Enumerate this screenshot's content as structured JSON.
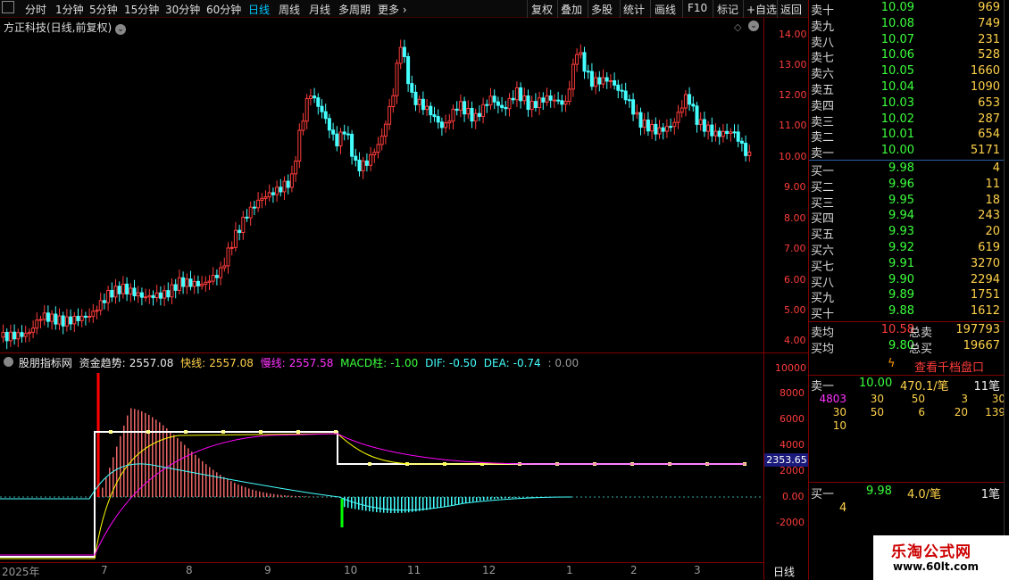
{
  "toolbar": {
    "periods": [
      "分时",
      "1分钟",
      "5分钟",
      "15分钟",
      "30分钟",
      "60分钟",
      "日线",
      "周线",
      "月线",
      "多周期",
      "更多"
    ],
    "active_period": "日线",
    "right_items": [
      "复权",
      "叠加",
      "多股",
      "统计",
      "画线",
      "F10",
      "标记",
      "+自选",
      "返回"
    ]
  },
  "main_title": "方正科技(日线,前复权)",
  "price_axis": [
    "14.00",
    "13.00",
    "12.00",
    "11.00",
    "10.00",
    "9.00",
    "8.00",
    "7.00",
    "6.00",
    "5.00",
    "4.00"
  ],
  "indicator_axis": [
    "10000",
    "8000",
    "6000",
    "4000",
    "2000",
    "0.00",
    "-2000"
  ],
  "indicator_value_badge": "2353.65",
  "legend": {
    "name": "股朋指标网",
    "trend_label": "资金趋势:",
    "trend_value": "2557.08",
    "fast_label": "快线:",
    "fast_value": "2557.08",
    "slow_label": "慢线:",
    "slow_value": "2557.58",
    "macd_label": "MACD柱:",
    "macd_value": "-1.00",
    "dif_label": "DIF:",
    "dif_value": "-0.50",
    "dea_label": "DEA:",
    "dea_value": "-0.74",
    "extra": ": 0.00"
  },
  "date_axis": {
    "labels": [
      "2025年",
      "7",
      "8",
      "9",
      "10",
      "11",
      "12",
      "1",
      "2",
      "3"
    ],
    "period": "日线"
  },
  "orderbook": {
    "asks": [
      {
        "label": "卖十",
        "price": "10.09",
        "vol": "969"
      },
      {
        "label": "卖九",
        "price": "10.08",
        "vol": "749"
      },
      {
        "label": "卖八",
        "price": "10.07",
        "vol": "231"
      },
      {
        "label": "卖七",
        "price": "10.06",
        "vol": "528"
      },
      {
        "label": "卖六",
        "price": "10.05",
        "vol": "1660"
      },
      {
        "label": "卖五",
        "price": "10.04",
        "vol": "1090"
      },
      {
        "label": "卖四",
        "price": "10.03",
        "vol": "653"
      },
      {
        "label": "卖三",
        "price": "10.02",
        "vol": "287"
      },
      {
        "label": "卖二",
        "price": "10.01",
        "vol": "654"
      },
      {
        "label": "卖一",
        "price": "10.00",
        "vol": "5171"
      }
    ],
    "bids": [
      {
        "label": "买一",
        "price": "9.98",
        "vol": "4"
      },
      {
        "label": "买二",
        "price": "9.96",
        "vol": "11"
      },
      {
        "label": "买三",
        "price": "9.95",
        "vol": "18"
      },
      {
        "label": "买四",
        "price": "9.94",
        "vol": "243"
      },
      {
        "label": "买五",
        "price": "9.93",
        "vol": "20"
      },
      {
        "label": "买六",
        "price": "9.92",
        "vol": "619"
      },
      {
        "label": "买七",
        "price": "9.91",
        "vol": "3270"
      },
      {
        "label": "买八",
        "price": "9.90",
        "vol": "2294"
      },
      {
        "label": "买九",
        "price": "9.89",
        "vol": "1751"
      },
      {
        "label": "买十",
        "price": "9.88",
        "vol": "1612"
      }
    ],
    "avg_ask_label": "卖均",
    "avg_ask": "10.58",
    "total_ask_label": "总卖",
    "total_ask": "197793",
    "avg_bid_label": "买均",
    "avg_bid": "9.80",
    "total_bid_label": "总买",
    "total_bid": "19667"
  },
  "thousand_link": "查看千档盘口",
  "queue": {
    "ask_label": "卖一",
    "ask_price": "10.00",
    "ask_avg": "470.1/笔",
    "ask_count": "11笔",
    "ask_rows": [
      [
        "4803",
        "30",
        "50",
        "3",
        "30"
      ],
      [
        "30",
        "50",
        "6",
        "20",
        "139"
      ],
      [
        "10"
      ]
    ],
    "bid_label": "买一",
    "bid_price": "9.98",
    "bid_avg": "4.0/笔",
    "bid_count": "1笔",
    "bid_rows": [
      [
        "4"
      ]
    ]
  },
  "watermark": {
    "line1": "乐淘公式网",
    "line2": "www.60lt.com"
  },
  "colors": {
    "up": "#ff3c3c",
    "down": "#4ff",
    "bg": "#000000",
    "axis": "#800000"
  }
}
